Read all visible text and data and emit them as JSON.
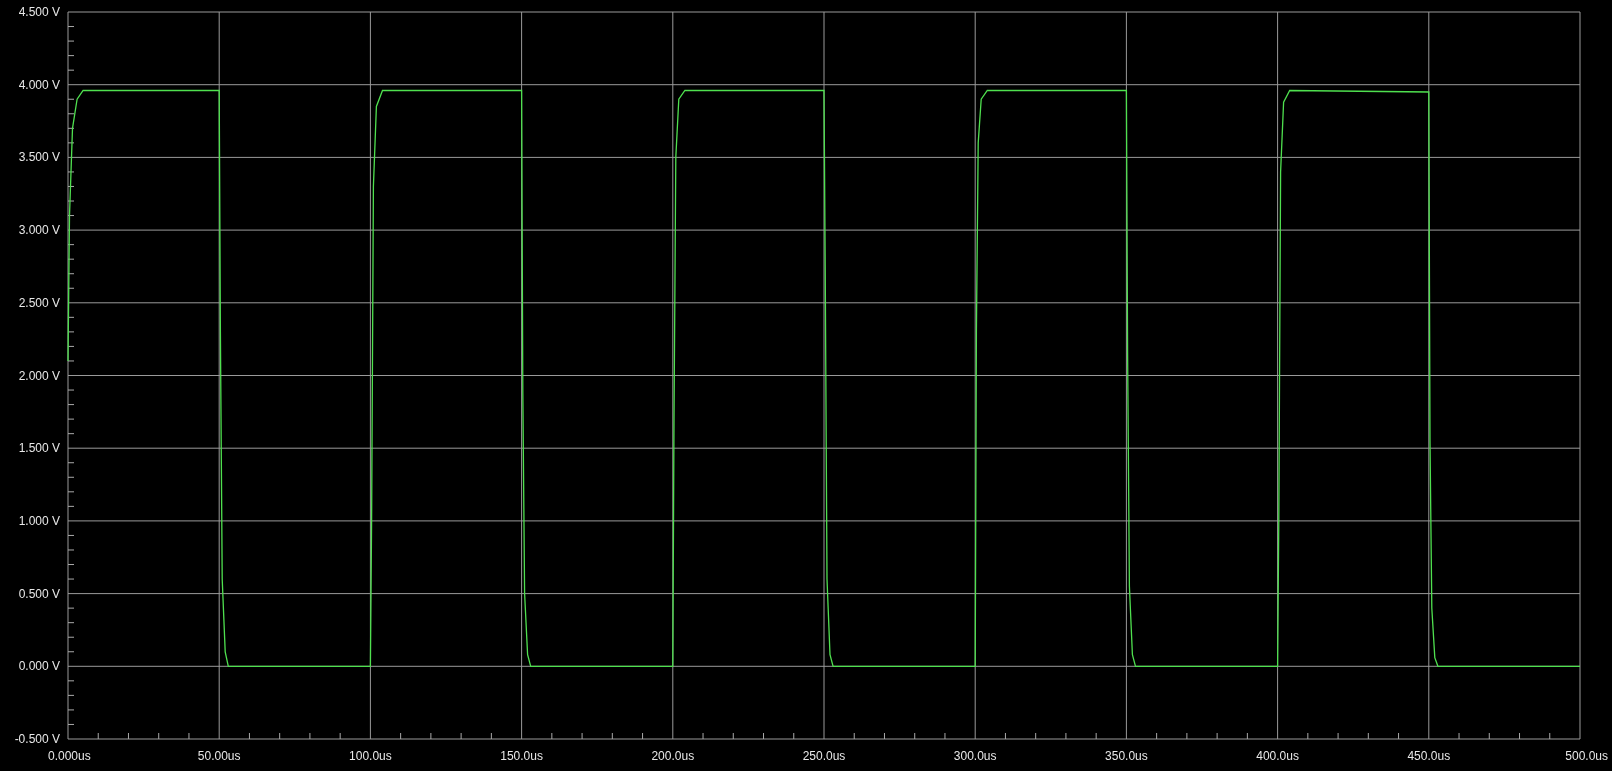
{
  "plot": {
    "chart_data": {
      "type": "line",
      "x": [
        0,
        0.5,
        1.5,
        3,
        5,
        50,
        50.4,
        51,
        52,
        53,
        100,
        100.4,
        101,
        102,
        104,
        150,
        150.4,
        151,
        152,
        153,
        200,
        200.4,
        201,
        202,
        204,
        250,
        250.4,
        251,
        252,
        253,
        300,
        300.4,
        301,
        302,
        304,
        350,
        350.4,
        351,
        352,
        353,
        400,
        400.4,
        401,
        402,
        404,
        450,
        450.4,
        451,
        452,
        453,
        500
      ],
      "series": [
        {
          "color": "#4fe04f",
          "values": [
            2.1,
            3.1,
            3.7,
            3.9,
            3.96,
            3.96,
            2.3,
            0.6,
            0.1,
            0.0,
            0.0,
            1.0,
            3.3,
            3.85,
            3.96,
            3.96,
            1.9,
            0.5,
            0.08,
            0.0,
            0.0,
            1.7,
            3.5,
            3.9,
            3.96,
            3.96,
            2.75,
            0.6,
            0.08,
            0.0,
            0.0,
            2.3,
            3.6,
            3.9,
            3.96,
            3.96,
            2.15,
            0.55,
            0.08,
            0.0,
            0.0,
            1.0,
            3.4,
            3.88,
            3.96,
            3.95,
            1.55,
            0.4,
            0.06,
            0.0,
            0.0
          ]
        }
      ],
      "grid": true,
      "xlim": [
        0,
        500
      ],
      "ylim": [
        -0.5,
        4.5
      ],
      "xticks": [
        {
          "value": 0,
          "label": "0.000us"
        },
        {
          "value": 50,
          "label": "50.00us"
        },
        {
          "value": 100,
          "label": "100.0us"
        },
        {
          "value": 150,
          "label": "150.0us"
        },
        {
          "value": 200,
          "label": "200.0us"
        },
        {
          "value": 250,
          "label": "250.0us"
        },
        {
          "value": 300,
          "label": "300.0us"
        },
        {
          "value": 350,
          "label": "350.0us"
        },
        {
          "value": 400,
          "label": "400.0us"
        },
        {
          "value": 450,
          "label": "450.0us"
        },
        {
          "value": 500,
          "label": "500.0us"
        }
      ],
      "yticks": [
        {
          "value": 4.5,
          "label": "4.500 V"
        },
        {
          "value": 4,
          "label": "4.000 V"
        },
        {
          "value": 3.5,
          "label": "3.500 V"
        },
        {
          "value": 3,
          "label": "3.000 V"
        },
        {
          "value": 2.5,
          "label": "2.500 V"
        },
        {
          "value": 2,
          "label": "2.000 V"
        },
        {
          "value": 1.5,
          "label": "1.500 V"
        },
        {
          "value": 1,
          "label": "1.000 V"
        },
        {
          "value": 0.5,
          "label": "0.500 V"
        },
        {
          "value": 0,
          "label": "0.000 V"
        },
        {
          "value": -0.5,
          "label": "-0.500 V"
        }
      ]
    }
  }
}
